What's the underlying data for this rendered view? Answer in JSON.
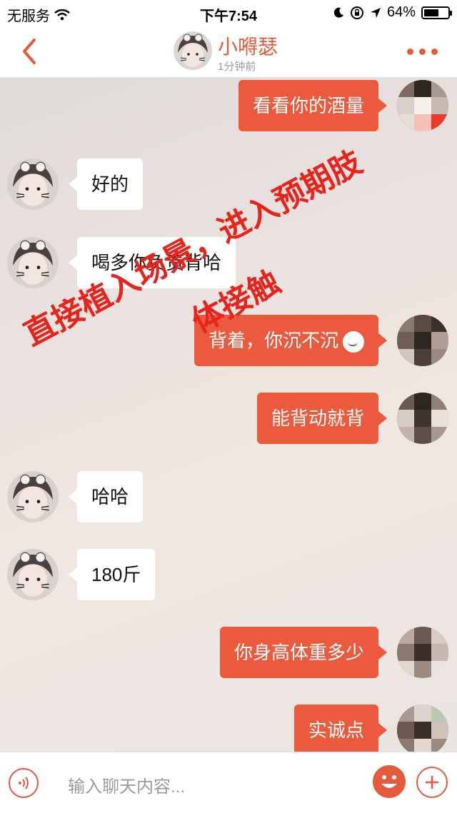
{
  "status_bar": {
    "carrier": "无服务",
    "time": "下午7:54",
    "battery_percent": "64%",
    "battery_level": 0.64
  },
  "header": {
    "contact_name": "小嘚瑟",
    "subtitle": "1分钟前",
    "icons": {
      "back": "chevron-left-icon",
      "more": "more-dots-icon"
    }
  },
  "messages": [
    {
      "direction": "out",
      "text": "看看你的酒量"
    },
    {
      "direction": "in",
      "text": "好的"
    },
    {
      "direction": "in",
      "text": "喝多你负责背哈"
    },
    {
      "direction": "out",
      "text": "背着，你沉不沉",
      "emoji": "smile-emoji"
    },
    {
      "direction": "out",
      "text": "能背动就背"
    },
    {
      "direction": "in",
      "text": "哈哈"
    },
    {
      "direction": "in",
      "text": "180斤"
    },
    {
      "direction": "out",
      "text": "你身高体重多少"
    },
    {
      "direction": "out",
      "text": "实诚点"
    }
  ],
  "watermark": {
    "line1": "直接植入场景，进入预期肢",
    "line2": "体接触",
    "color": "#e8231b"
  },
  "input_bar": {
    "placeholder": "输入聊天内容...",
    "icons": {
      "voice": "voice-icon",
      "emoji": "emoji-icon",
      "plus": "plus-icon"
    }
  },
  "colors": {
    "accent": "#e55a3c",
    "outgoing_bubble": "#ec5a3d",
    "incoming_bubble": "#ffffff"
  }
}
